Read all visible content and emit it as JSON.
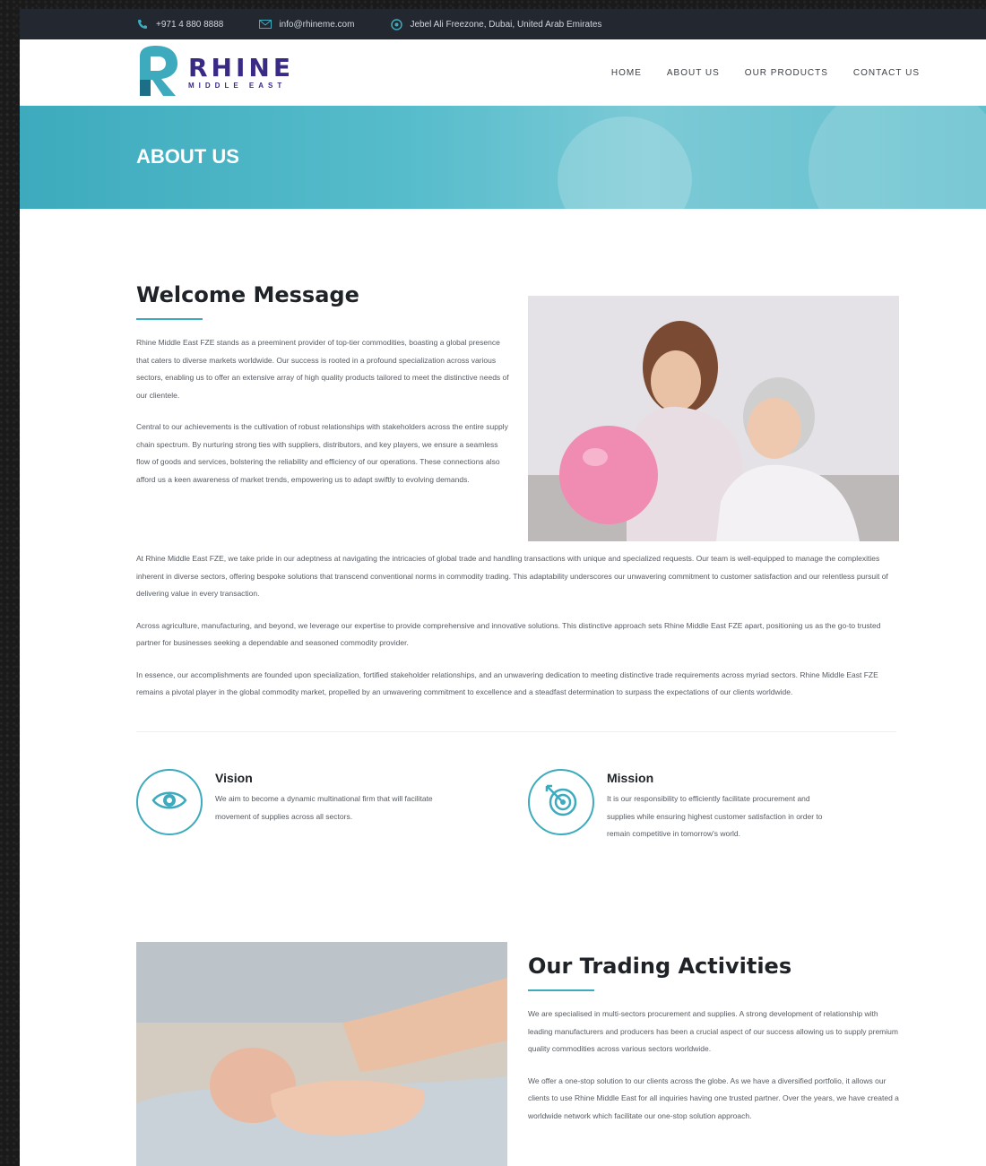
{
  "topbar": {
    "phone": "+971 4 880 8888",
    "email": "info@rhineme.com",
    "address": "Jebel Ali Freezone, Dubai, United Arab Emirates"
  },
  "header": {
    "logo_main": "RHINE",
    "logo_sub": "MIDDLE EAST",
    "nav": [
      "HOME",
      "ABOUT US",
      "OUR PRODUCTS",
      "CONTACT US"
    ]
  },
  "hero": {
    "title": "ABOUT US"
  },
  "welcome": {
    "title": "Welcome Message",
    "paragraphs": [
      "Rhine Middle East FZE stands as a preeminent provider of top-tier commodities, boasting a global presence that caters to diverse markets worldwide. Our success is rooted in a profound specialization across various sectors, enabling us to offer an extensive array of high quality products tailored to meet the distinctive needs of our clientele.",
      "Central to our achievements is the cultivation of robust relationships with stakeholders across the entire supply chain spectrum. By nurturing strong ties with suppliers, distributors, and key players, we ensure a seamless flow of goods and services, bolstering the reliability and efficiency of our operations. These connections also afford us a keen awareness of market trends, empowering us to adapt swiftly to evolving demands."
    ],
    "full_paragraphs": [
      "At Rhine Middle East FZE, we take pride in our adeptness at navigating the intricacies of global trade and handling transactions with unique and specialized requests. Our team is well-equipped to manage the complexities inherent in diverse sectors, offering bespoke solutions that transcend conventional norms in commodity trading. This adaptability underscores our unwavering commitment to customer satisfaction and our relentless pursuit of delivering value in every transaction.",
      "Across agriculture, manufacturing, and beyond, we leverage our expertise to provide comprehensive and innovative solutions. This distinctive approach sets Rhine Middle East FZE apart, positioning us as the go-to trusted partner for businesses seeking a dependable and seasoned commodity provider.",
      "In essence, our accomplishments are founded upon specialization, fortified stakeholder relationships, and an unwavering dedication to meeting distinctive trade requirements across myriad sectors. Rhine Middle East FZE remains a pivotal player in the global commodity market, propelled by an unwavering commitment to excellence and a steadfast determination to surpass the expectations of our clients worldwide."
    ]
  },
  "vision": {
    "title": "Vision",
    "text": "We aim to become a dynamic multinational firm that will facilitate movement of supplies across all sectors.",
    "icon": "eye-icon"
  },
  "mission": {
    "title": "Mission",
    "text": "It is our responsibility to efficiently facilitate procurement and supplies while ensuring highest customer satisfaction in order to remain competitive in tomorrow's world.",
    "icon": "target-icon"
  },
  "trading": {
    "title": "Our Trading Activities",
    "paragraphs": [
      "We are specialised in multi-sectors procurement and supplies. A strong development of relationship with leading manufacturers and producers has been a crucial aspect of our success allowing us to supply premium quality commodities across various sectors worldwide.",
      "We offer a one-stop solution to our clients across the globe. As we have a diversified portfolio, it allows our clients to use Rhine Middle East for all inquiries having one trusted partner. Over the years, we have created a worldwide network which facilitate our one-stop solution approach."
    ]
  },
  "colors": {
    "accent": "#3dabbd",
    "brand": "#3a2a86",
    "topbar": "#232830"
  }
}
